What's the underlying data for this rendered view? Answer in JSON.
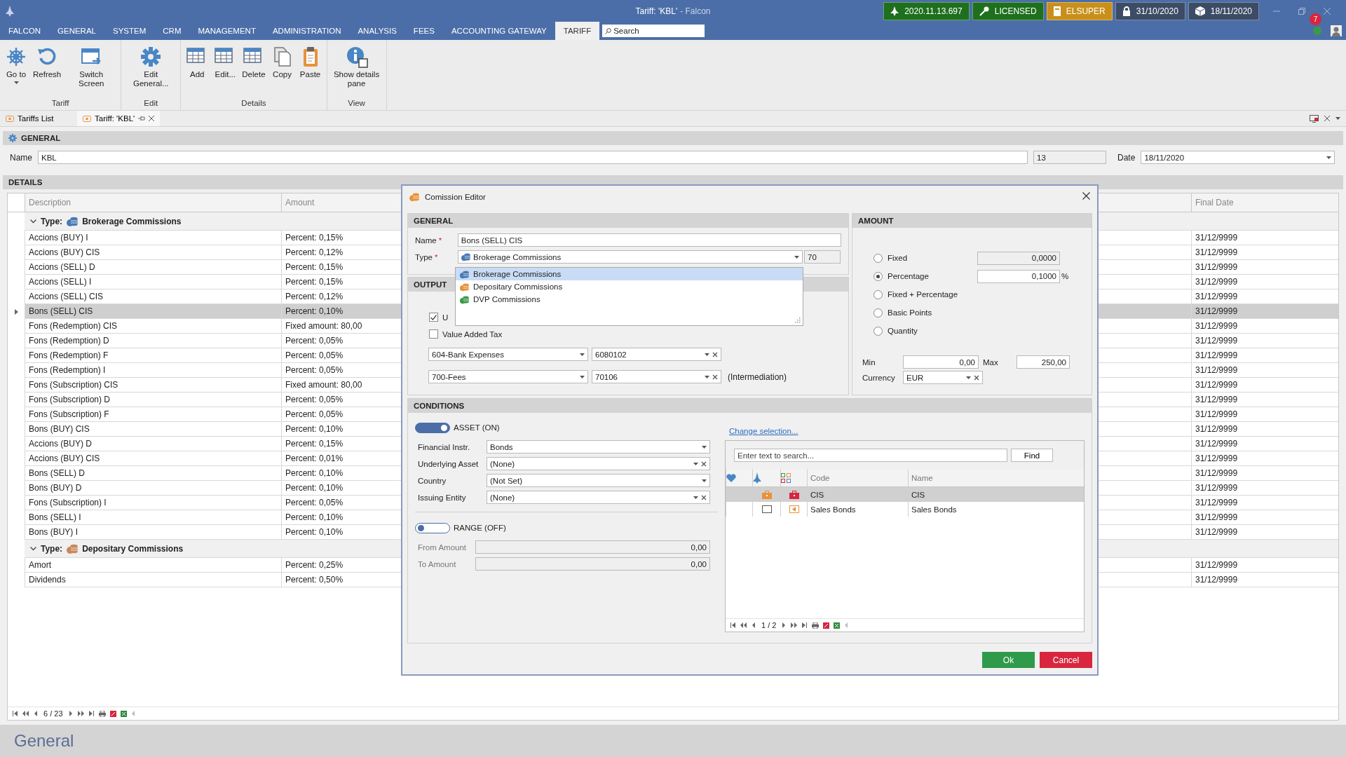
{
  "window": {
    "title": "Tariff: 'KBL'",
    "app_name": "- Falcon"
  },
  "status_badges": [
    {
      "kind": "build",
      "text": "2020.11.13.697",
      "color": "#1e6f1e"
    },
    {
      "kind": "key",
      "text": "LICENSED",
      "color": "#1e6f1e"
    },
    {
      "kind": "user",
      "text": "ELSUPER",
      "color": "#c8901a"
    },
    {
      "kind": "lock",
      "text": "31/10/2020",
      "color": "#3c4c66"
    },
    {
      "kind": "cube",
      "text": "18/11/2020",
      "color": "#3c4c66"
    }
  ],
  "notifications": {
    "count": "7"
  },
  "menu": [
    {
      "label": "FALCON",
      "selected": false
    },
    {
      "label": "GENERAL",
      "selected": false
    },
    {
      "label": "SYSTEM",
      "selected": false
    },
    {
      "label": "CRM",
      "selected": false
    },
    {
      "label": "MANAGEMENT",
      "selected": false
    },
    {
      "label": "ADMINISTRATION",
      "selected": false
    },
    {
      "label": "ANALYSIS",
      "selected": false
    },
    {
      "label": "FEES",
      "selected": false
    },
    {
      "label": "ACCOUNTING GATEWAY",
      "selected": false
    },
    {
      "label": "TARIFF",
      "selected": true
    }
  ],
  "search": {
    "placeholder": "Search"
  },
  "ribbon": [
    {
      "label": "Tariff",
      "buttons": [
        {
          "label": "Go to",
          "kind": "goto",
          "dropdown": true
        },
        {
          "label": "Refresh",
          "kind": "refresh",
          "dropdown": false
        },
        {
          "label": "Switch Screen",
          "kind": "switch",
          "dropdown": false
        }
      ]
    },
    {
      "label": "Edit",
      "buttons": [
        {
          "label": "Edit General...",
          "kind": "gear",
          "dropdown": false
        }
      ]
    },
    {
      "label": "Details",
      "buttons": [
        {
          "label": "Add",
          "kind": "add",
          "dropdown": false
        },
        {
          "label": "Edit...",
          "kind": "edit",
          "dropdown": false
        },
        {
          "label": "Delete",
          "kind": "delete",
          "dropdown": false
        },
        {
          "label": "Copy",
          "kind": "copy",
          "dropdown": false
        },
        {
          "label": "Paste",
          "kind": "paste",
          "dropdown": false
        }
      ]
    },
    {
      "label": "View",
      "buttons": [
        {
          "label": "Show details pane",
          "kind": "info",
          "dropdown": false
        }
      ]
    }
  ],
  "doc_tabs": [
    {
      "label": "Tariffs List",
      "selected": false
    },
    {
      "label": "Tariff: 'KBL'",
      "selected": true
    }
  ],
  "general": {
    "title": "GENERAL",
    "name_label": "Name",
    "name": "KBL",
    "code": "13",
    "date_label": "Date",
    "date": "18/11/2020"
  },
  "details": {
    "title": "DETAILS",
    "columns": [
      "Description",
      "Amount",
      "Final Date"
    ],
    "pager": "6 / 23",
    "groups": [
      {
        "label": "Type:",
        "name": "Brokerage Commissions",
        "color": "#4a7ab5",
        "expanded": true,
        "rows": [
          {
            "description": "Accions (BUY) I",
            "amount": "Percent: 0,15%",
            "final_date": "31/12/9999",
            "selected": false
          },
          {
            "description": "Accions (BUY) CIS",
            "amount": "Percent: 0,12%",
            "final_date": "31/12/9999",
            "selected": false
          },
          {
            "description": "Accions (SELL) D",
            "amount": "Percent: 0,15%",
            "final_date": "31/12/9999",
            "selected": false
          },
          {
            "description": "Accions (SELL) I",
            "amount": "Percent: 0,15%",
            "final_date": "31/12/9999",
            "selected": false
          },
          {
            "description": "Accions (SELL) CIS",
            "amount": "Percent: 0,12%",
            "final_date": "31/12/9999",
            "selected": false
          },
          {
            "description": "Bons (SELL) CIS",
            "amount": "Percent: 0,10%",
            "final_date": "31/12/9999",
            "selected": true
          },
          {
            "description": "Fons (Redemption) CIS",
            "amount": "Fixed amount: 80,00",
            "final_date": "31/12/9999",
            "selected": false
          },
          {
            "description": "Fons (Redemption) D",
            "amount": "Percent: 0,05%",
            "final_date": "31/12/9999",
            "selected": false
          },
          {
            "description": "Fons (Redemption) F",
            "amount": "Percent: 0,05%",
            "final_date": "31/12/9999",
            "selected": false
          },
          {
            "description": "Fons (Redemption) I",
            "amount": "Percent: 0,05%",
            "final_date": "31/12/9999",
            "selected": false
          },
          {
            "description": "Fons (Subscription) CIS",
            "amount": "Fixed amount: 80,00",
            "final_date": "31/12/9999",
            "selected": false
          },
          {
            "description": "Fons (Subscription) D",
            "amount": "Percent: 0,05%",
            "final_date": "31/12/9999",
            "selected": false
          },
          {
            "description": "Fons (Subscription) F",
            "amount": "Percent: 0,05%",
            "final_date": "31/12/9999",
            "selected": false
          },
          {
            "description": "Bons (BUY) CIS",
            "amount": "Percent: 0,10%",
            "final_date": "31/12/9999",
            "selected": false
          },
          {
            "description": "Accions (BUY) D",
            "amount": "Percent: 0,15%",
            "final_date": "31/12/9999",
            "selected": false
          },
          {
            "description": "Accions (BUY) CIS",
            "amount": "Percent: 0,01%",
            "final_date": "31/12/9999",
            "selected": false
          },
          {
            "description": "Bons (SELL) D",
            "amount": "Percent: 0,10%",
            "final_date": "31/12/9999",
            "selected": false
          },
          {
            "description": "Bons (BUY) D",
            "amount": "Percent: 0,10%",
            "final_date": "31/12/9999",
            "selected": false
          },
          {
            "description": "Fons (Subscription) I",
            "amount": "Percent: 0,05%",
            "final_date": "31/12/9999",
            "selected": false
          },
          {
            "description": "Bons (SELL) I",
            "amount": "Percent: 0,10%",
            "final_date": "31/12/9999",
            "selected": false
          },
          {
            "description": "Bons (BUY) I",
            "amount": "Percent: 0,10%",
            "final_date": "31/12/9999",
            "selected": false
          }
        ]
      },
      {
        "label": "Type:",
        "name": "Depositary Commissions",
        "color": "#c9865a",
        "expanded": true,
        "rows": [
          {
            "description": "Amort",
            "amount": "Percent: 0,25%",
            "final_date": "31/12/9999",
            "selected": false
          },
          {
            "description": "Dividends",
            "amount": "Percent: 0,50%",
            "final_date": "31/12/9999",
            "selected": false
          }
        ]
      }
    ]
  },
  "dialog": {
    "title": "Comission Editor",
    "general": {
      "title": "GENERAL",
      "name": {
        "label": "Name",
        "mark": "*",
        "value": "Bons (SELL) CIS"
      },
      "type": {
        "label": "Type",
        "mark": "*",
        "value": "Brokerage Commissions",
        "code": "70",
        "color": "#4a7ab5"
      }
    },
    "type_options": [
      {
        "label": "Brokerage Commissions",
        "color": "#4a7ab5",
        "selected": true
      },
      {
        "label": "Depositary Commissions",
        "color": "#e8923a",
        "selected": false
      },
      {
        "label": "DVP Commissions",
        "color": "#3a9a4a",
        "selected": false
      }
    ],
    "output": {
      "title": "OUTPUT",
      "checks": [
        {
          "label": "U",
          "checked": true
        },
        {
          "label": "Value Added Tax",
          "checked": false
        }
      ],
      "accounts": [
        {
          "account": "604-Bank Expenses",
          "subaccount": "6080102"
        },
        {
          "account": "700-Fees",
          "subaccount": "70106",
          "note": "(Intermediation)"
        }
      ]
    },
    "amount": {
      "title": "AMOUNT",
      "options": [
        {
          "label": "Fixed",
          "selected": false,
          "value": "0,0000"
        },
        {
          "label": "Percentage",
          "selected": true,
          "value": "0,1000",
          "unit": "%"
        },
        {
          "label": "Fixed + Percentage",
          "selected": false
        },
        {
          "label": "Basic Points",
          "selected": false
        },
        {
          "label": "Quantity",
          "selected": false
        }
      ],
      "min_label": "Min",
      "min": "0,00",
      "max_label": "Max",
      "max": "250,00",
      "currency_label": "Currency",
      "currency": "EUR"
    },
    "conditions": {
      "title": "CONDITIONS",
      "asset_toggle": {
        "label": "ASSET (ON)",
        "on": true
      },
      "filters": [
        {
          "label": "Financial Instr.",
          "value": "Bonds",
          "clearable": false
        },
        {
          "label": "Underlying Asset",
          "value": "(None)",
          "clearable": true
        },
        {
          "label": "Country",
          "value": "(Not Set)",
          "clearable": false
        },
        {
          "label": "Issuing Entity",
          "value": "(None)",
          "clearable": true
        }
      ],
      "range_toggle": {
        "label": "RANGE (OFF)",
        "on": false
      },
      "range_fields": [
        {
          "label": "From Amount",
          "value": "0,00"
        },
        {
          "label": "To Amount",
          "value": "0,00"
        }
      ],
      "change_link": "Change selection...",
      "search_placeholder": "Enter text to search...",
      "find": "Find",
      "columns": [
        "Code",
        "Name"
      ],
      "rows": [
        {
          "code": "CIS",
          "name": "CIS",
          "selected": true,
          "kind": "briefcase"
        },
        {
          "code": "Sales Bonds",
          "name": "Sales Bonds",
          "selected": false,
          "kind": "bond"
        }
      ],
      "pager": "1 / 2"
    },
    "buttons": [
      {
        "label": "Ok",
        "kind": "primary"
      },
      {
        "label": "Cancel",
        "kind": "danger"
      }
    ]
  },
  "footer": {
    "title": "General"
  }
}
